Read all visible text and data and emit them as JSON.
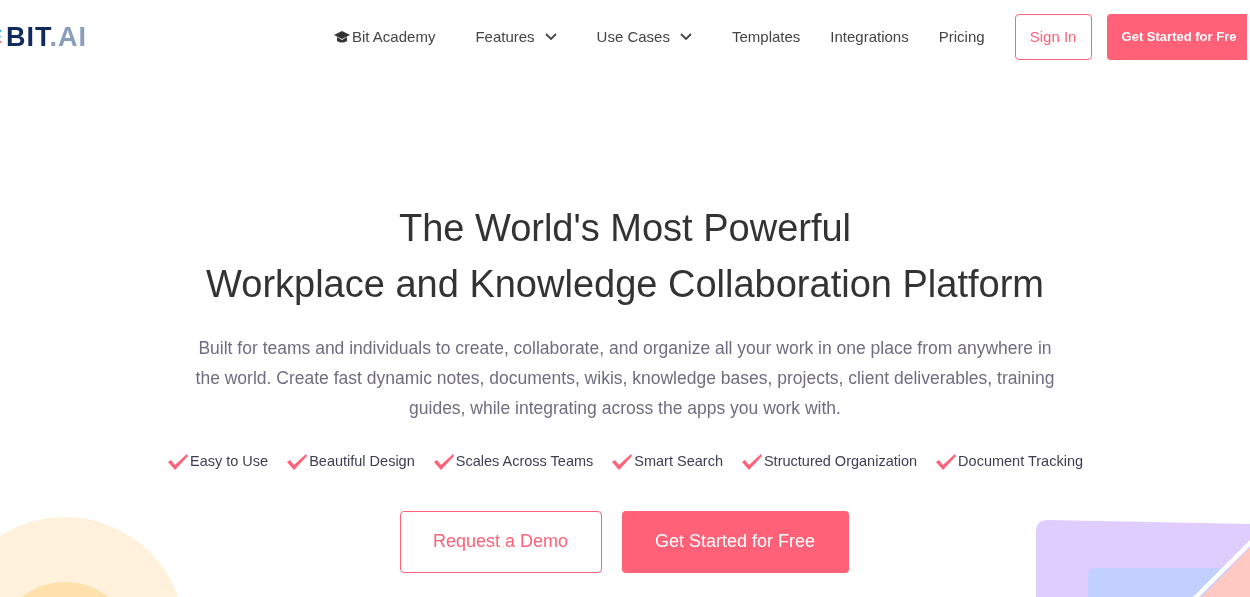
{
  "header": {
    "logo": {
      "primary": "BIT",
      "secondary": ".AI"
    },
    "nav": [
      {
        "label": "Bit Academy",
        "kind": "academy"
      },
      {
        "label": "Features",
        "kind": "dropdown"
      },
      {
        "label": "Use Cases",
        "kind": "dropdown"
      },
      {
        "label": "Templates",
        "kind": "link"
      },
      {
        "label": "Integrations",
        "kind": "link"
      },
      {
        "label": "Pricing",
        "kind": "link"
      }
    ],
    "sign_in": "Sign In",
    "get_started": "Get Started for Fre"
  },
  "hero": {
    "title_lines": [
      "The World's Most Powerful",
      "Workplace and Knowledge Collaboration Platform"
    ],
    "description": "Built for teams and individuals to create, collaborate, and organize all your work in one place from anywhere in the world. Create fast dynamic notes, documents, wikis, knowledge bases, projects, client deliverables, training guides, while integrating across the apps you work with.",
    "features": [
      "Easy to Use",
      "Beautiful Design",
      "Scales Across Teams",
      "Smart Search",
      "Structured Organization",
      "Document Tracking"
    ],
    "buttons": [
      {
        "label": "Request a Demo",
        "kind": "outline"
      },
      {
        "label": "Get Started for Free",
        "kind": "filled"
      }
    ]
  }
}
